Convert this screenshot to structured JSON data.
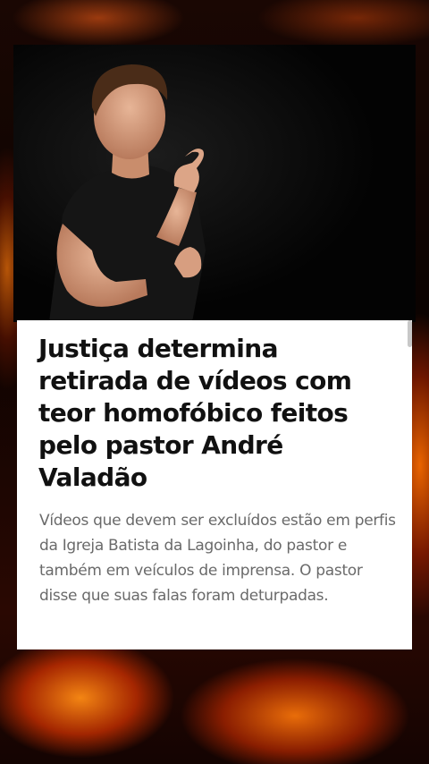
{
  "article": {
    "headline": "Justiça determina retirada de vídeos com teor homofóbico feitos pelo pastor André Valadão",
    "summary": "Vídeos que devem ser excluídos estão em perfis da Igreja Batista da Lagoinha, do pastor e também em veículos de imprensa. O pastor disse que suas falas foram deturpadas."
  },
  "colors": {
    "card_background": "#ffffff",
    "headline_text": "#111111",
    "summary_text": "#6a6a6a",
    "fire_orange": "#ff7a10"
  }
}
